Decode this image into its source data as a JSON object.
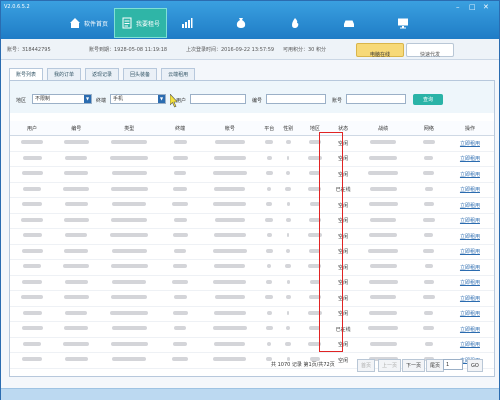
{
  "app": {
    "version": "V2.0.6.5.2"
  },
  "nav": [
    {
      "label": "软件首页",
      "icon": "home-icon"
    },
    {
      "label": "我要租号",
      "icon": "clipboard-icon",
      "active": true
    },
    {
      "label": "",
      "icon": "chart-icon"
    },
    {
      "label": "",
      "icon": "money-bag-icon"
    },
    {
      "label": "",
      "icon": "flame-icon"
    },
    {
      "label": "",
      "icon": "car-icon"
    },
    {
      "label": "",
      "icon": "monitor-icon"
    }
  ],
  "info": {
    "account": "账号：318442795",
    "expire": "账号到期：1928-05-08 11:19:18",
    "last_login": "上次登录时间：2016-09-22 13:57:59",
    "points": "可用积分：30 积分",
    "btn_online": "电脑在线",
    "btn_fast": "快速代发"
  },
  "tabs": [
    "账号列表",
    "我的订单",
    "返现记录",
    "回头装备",
    "云端租用"
  ],
  "filters": {
    "region_label": "地区",
    "region_value": "不限制",
    "terminal_label": "终端",
    "terminal_value": "手机",
    "user_label": "用户",
    "no_label": "编号",
    "account_label": "账号",
    "search_btn": "查询"
  },
  "table": {
    "headers": [
      "用户",
      "编号",
      "类型",
      "终端",
      "帐号",
      "平台",
      "性别",
      "地区",
      "状态",
      "战绩",
      "网络",
      "操作"
    ],
    "statuses": [
      "空闲",
      "空闲",
      "空闲",
      "已在线",
      "空闲",
      "空闲",
      "空闲",
      "空闲",
      "空闲",
      "空闲",
      "空闲",
      "空闲",
      "已在线",
      "空闲",
      "空闲"
    ],
    "action_label": "立即租用"
  },
  "pagination": {
    "summary": "共 1070 记录 第1页/共72页",
    "first": "首页",
    "prev": "上一页",
    "next": "下一页",
    "last": "尾页",
    "page_value": "1",
    "go": "GO"
  },
  "colors": {
    "accent": "#2b6cb0",
    "highlight_box": "#e02424",
    "search_btn": "#2ab3a7"
  }
}
